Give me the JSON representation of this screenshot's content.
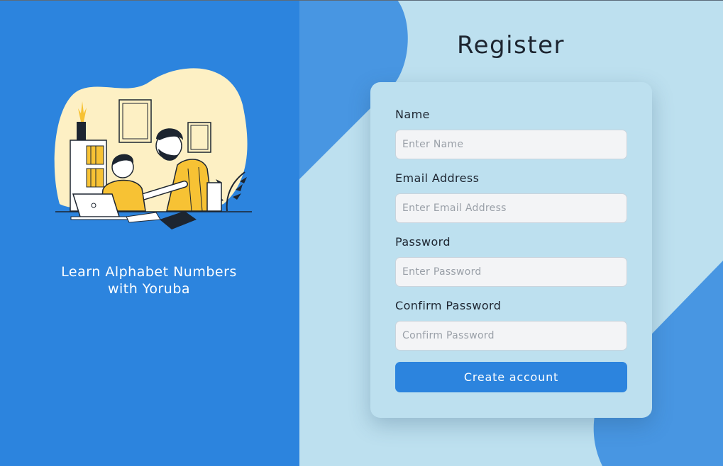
{
  "brand": {
    "tagline_line1": "Learn Alphabet Numbers",
    "tagline_line2": "with Yoruba",
    "illustration_icon": "teacher-and-student-illustration"
  },
  "form": {
    "title": "Register",
    "name": {
      "label": "Name",
      "placeholder": "Enter Name",
      "value": ""
    },
    "email": {
      "label": "Email Address",
      "placeholder": "Enter Email Address",
      "value": ""
    },
    "password": {
      "label": "Password",
      "placeholder": "Enter Password",
      "value": ""
    },
    "confirm": {
      "label": "Confirm Password",
      "placeholder": "Confirm Password",
      "value": ""
    },
    "submit_label": "Create account"
  },
  "colors": {
    "primary": "#2c84de",
    "background": "#bde0ef",
    "input_bg": "#f3f4f6",
    "text": "#1d2530",
    "illustration_blob": "#fdf0c4",
    "illustration_accent": "#f7c234"
  }
}
